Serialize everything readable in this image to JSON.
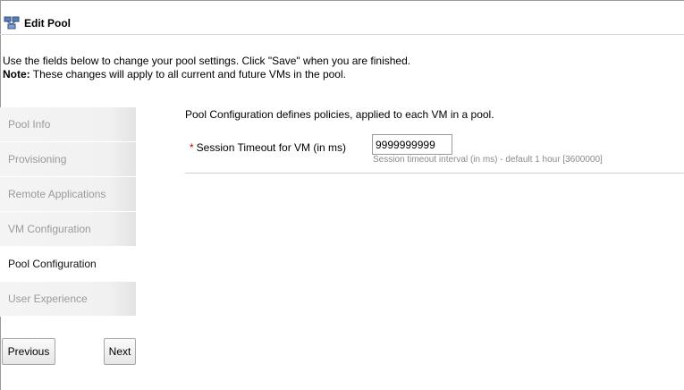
{
  "header": {
    "icon": "pool-network-icon",
    "title": "Edit Pool"
  },
  "intro": {
    "line1": "Use the fields below to change your pool settings. Click \"Save\" when you are finished.",
    "note_label": "Note:",
    "note_text": " These changes will apply to all current and future VMs in the pool."
  },
  "nav": {
    "items": [
      {
        "label": "Pool Info"
      },
      {
        "label": "Provisioning"
      },
      {
        "label": "Remote Applications"
      },
      {
        "label": "VM Configuration"
      },
      {
        "label": "Pool Configuration",
        "active": true
      },
      {
        "label": "User Experience"
      }
    ],
    "previous_label": "Previous",
    "next_label": "Next"
  },
  "main": {
    "description": "Pool Configuration defines policies, applied to each VM in a pool.",
    "field": {
      "required_mark": "*",
      "label": "Session Timeout for VM (in ms)",
      "value": "9999999999",
      "help": "Session timeout interval (in ms) - default 1 hour [3600000]"
    }
  },
  "colors": {
    "required": "#cc0000",
    "inactive_nav_text": "#9a9a9a",
    "help_text": "#8a8a8a"
  }
}
